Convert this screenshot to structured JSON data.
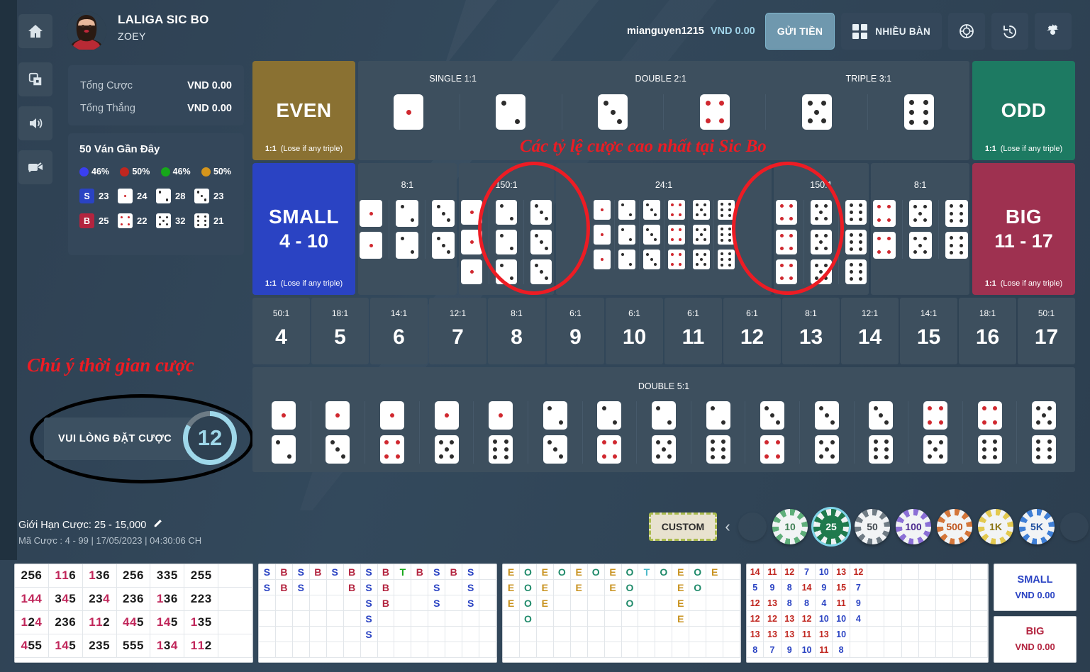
{
  "header": {
    "home_icon": "home-icon",
    "table_title": "LALIGA SIC BO",
    "dealer_name": "ZOEY",
    "username": "mianguyen1215",
    "balance": "VND 0.00",
    "deposit_label": "GỬI TIỀN",
    "multi_table_label": "NHIỀU BÀN",
    "icons": [
      "grid-icon",
      "chip-icon",
      "history-icon",
      "gear-icon"
    ]
  },
  "sidebar": {
    "icons": [
      "swap-table-icon",
      "sound-icon",
      "video-icon"
    ],
    "stats": {
      "total_bet_label": "Tổng Cược",
      "total_bet_value": "VND 0.00",
      "total_win_label": "Tổng Thắng",
      "total_win_value": "VND 0.00"
    },
    "recent": {
      "title": "50 Ván Gần Đây",
      "percents": [
        {
          "color": "#3a3ff0",
          "value": "46%"
        },
        {
          "color": "#c0261f",
          "value": "50%"
        },
        {
          "color": "#17a81a",
          "value": "46%"
        },
        {
          "color": "#d4951c",
          "value": "50%"
        }
      ],
      "row1": [
        {
          "badge": "S",
          "badge_color": "#2a43c3",
          "count": "23"
        },
        {
          "face": 1,
          "count": "24"
        },
        {
          "face": 2,
          "count": "28"
        },
        {
          "face": 3,
          "count": "23"
        }
      ],
      "row2": [
        {
          "badge": "B",
          "badge_color": "#b3243f",
          "count": "25"
        },
        {
          "face": 4,
          "count": "22"
        },
        {
          "face": 5,
          "count": "32"
        },
        {
          "face": 6,
          "count": "21"
        }
      ]
    }
  },
  "annotations": {
    "top_note": "Các tỷ lệ cược cao nhất tại Sic Bo",
    "timer_note": "Chú ý thời gian cược"
  },
  "timer": {
    "message": "VUI LÒNG ĐẶT CƯỢC",
    "seconds": "12"
  },
  "board": {
    "even": {
      "title": "EVEN",
      "odds": "1:1",
      "note": "(Lose if any triple)"
    },
    "odd": {
      "title": "ODD",
      "odds": "1:1",
      "note": "(Lose if any triple)"
    },
    "small": {
      "title": "SMALL",
      "range": "4 - 10",
      "odds": "1:1",
      "note": "(Lose if any triple)"
    },
    "big": {
      "title": "BIG",
      "range": "11 - 17",
      "odds": "1:1",
      "note": "(Lose if any triple)"
    },
    "single_row": {
      "labels": [
        {
          "text": "SINGLE 1:1",
          "pos": 15.5
        },
        {
          "text": "DOUBLE 2:1",
          "pos": 49.5
        },
        {
          "text": "TRIPLE 3:1",
          "pos": 83.5
        }
      ],
      "faces": [
        1,
        2,
        3,
        4,
        5,
        6
      ]
    },
    "combos": [
      {
        "odds": "8:1",
        "type": "pair",
        "groups": [
          [
            1,
            1
          ],
          [
            2,
            2
          ],
          [
            3,
            3
          ]
        ]
      },
      {
        "odds": "150:1",
        "type": "triple",
        "groups": [
          [
            1,
            1,
            1
          ],
          [
            2,
            2,
            2
          ],
          [
            3,
            3,
            3
          ]
        ],
        "circled": true
      },
      {
        "odds": "24:1",
        "type": "anytriple",
        "groups": [
          [
            1,
            1,
            1
          ],
          [
            2,
            2,
            2
          ],
          [
            3,
            3,
            3
          ],
          [
            4,
            4,
            4
          ],
          [
            5,
            5,
            5
          ],
          [
            6,
            6,
            6
          ]
        ]
      },
      {
        "odds": "150:1",
        "type": "triple",
        "groups": [
          [
            4,
            4,
            4
          ],
          [
            5,
            5,
            5
          ],
          [
            6,
            6,
            6
          ]
        ],
        "circled": true
      },
      {
        "odds": "8:1",
        "type": "pair",
        "groups": [
          [
            4,
            4
          ],
          [
            5,
            5
          ],
          [
            6,
            6
          ]
        ]
      }
    ],
    "numbers": [
      {
        "odds": "50:1",
        "value": "4"
      },
      {
        "odds": "18:1",
        "value": "5"
      },
      {
        "odds": "14:1",
        "value": "6"
      },
      {
        "odds": "12:1",
        "value": "7"
      },
      {
        "odds": "8:1",
        "value": "8"
      },
      {
        "odds": "6:1",
        "value": "9"
      },
      {
        "odds": "6:1",
        "value": "10"
      },
      {
        "odds": "6:1",
        "value": "11"
      },
      {
        "odds": "6:1",
        "value": "12"
      },
      {
        "odds": "8:1",
        "value": "13"
      },
      {
        "odds": "12:1",
        "value": "14"
      },
      {
        "odds": "14:1",
        "value": "15"
      },
      {
        "odds": "18:1",
        "value": "16"
      },
      {
        "odds": "50:1",
        "value": "17"
      }
    ],
    "double_row": {
      "label": "DOUBLE 5:1",
      "pairs": [
        [
          1,
          2
        ],
        [
          1,
          3
        ],
        [
          1,
          4
        ],
        [
          1,
          5
        ],
        [
          1,
          6
        ],
        [
          2,
          3
        ],
        [
          2,
          4
        ],
        [
          2,
          5
        ],
        [
          2,
          6
        ],
        [
          3,
          4
        ],
        [
          3,
          5
        ],
        [
          3,
          6
        ],
        [
          4,
          5
        ],
        [
          4,
          6
        ],
        [
          5,
          6
        ]
      ]
    }
  },
  "footer": {
    "limit_label": "Giới Hạn Cược:",
    "limit_value": "25 - 15,000",
    "edit_icon": "pencil-icon",
    "code_text": "Mã Cược : 4 - 99 | 17/05/2023 | 04:30:06 CH"
  },
  "chips": {
    "custom_label": "CUSTOM",
    "prev_icon": "chevron-left-icon",
    "next_icon": "chevron-right-icon",
    "items": [
      {
        "label": "10",
        "ring": "#5fae7a",
        "text": "#3f7f55",
        "selected": false
      },
      {
        "label": "25",
        "ring": "#1f7a4d",
        "text": "#1f7a4d",
        "selected": true
      },
      {
        "label": "50",
        "ring": "#6f7b84",
        "text": "#424a50",
        "selected": false
      },
      {
        "label": "100",
        "ring": "#8b6fd6",
        "text": "#4b2a8f",
        "selected": false
      },
      {
        "label": "500",
        "ring": "#d4763a",
        "text": "#c0561f",
        "selected": false
      },
      {
        "label": "1K",
        "ring": "#e3c94f",
        "text": "#8a7312",
        "selected": false
      },
      {
        "label": "5K",
        "ring": "#3f7fd6",
        "text": "#1f4f9f",
        "selected": false
      }
    ]
  },
  "roadmaps": {
    "bead_results": {
      "cols": 7,
      "rows": 4,
      "values": [
        [
          "256",
          "116",
          "136",
          "256",
          "335",
          "255",
          ""
        ],
        [
          "144",
          "345",
          "234",
          "236",
          "136",
          "223",
          ""
        ],
        [
          "124",
          "236",
          "112",
          "445",
          "145",
          "135",
          ""
        ],
        [
          "455",
          "145",
          "235",
          "555",
          "134",
          "112",
          ""
        ]
      ],
      "red_digits": [
        "1",
        "4"
      ],
      "red_color": "#c0265a",
      "black_color": "#1a1a1a"
    },
    "bigsmall_road": {
      "cols": 14,
      "rows": 6,
      "colors": {
        "S": "#2a43c3",
        "B": "#b3243f",
        "T": "#17a81a"
      },
      "columns": [
        [
          "S",
          "S"
        ],
        [
          "B",
          "B"
        ],
        [
          "S",
          "S"
        ],
        [
          "B"
        ],
        [
          "S"
        ],
        [
          "B",
          "B"
        ],
        [
          "S",
          "S",
          "S",
          "S",
          "S"
        ],
        [
          "B",
          "B",
          "B"
        ],
        [
          "T"
        ],
        [
          "B"
        ],
        [
          "S",
          "S",
          "S"
        ],
        [
          "B"
        ],
        [
          "S",
          "S",
          "S"
        ],
        []
      ]
    },
    "evenodd_road": {
      "cols": 14,
      "rows": 6,
      "colors": {
        "E": "#c8921f",
        "O": "#1f8a6a",
        "T": "#4ab8c8"
      },
      "columns": [
        [
          "E",
          "E",
          "E"
        ],
        [
          "O",
          "O",
          "O",
          "O"
        ],
        [
          "E",
          "E",
          "E"
        ],
        [
          "O"
        ],
        [
          "E",
          "E"
        ],
        [
          "O"
        ],
        [
          "E",
          "E"
        ],
        [
          "O",
          "O",
          "O"
        ],
        [
          "T"
        ],
        [
          "O"
        ],
        [
          "E",
          "E",
          "E",
          "E"
        ],
        [
          "O",
          "O"
        ],
        [
          "E"
        ],
        []
      ]
    },
    "totals_road": {
      "cols": 14,
      "rows": 6,
      "big_color": "#c0261f",
      "small_color": "#2a43c3",
      "rows_values": [
        [
          "14",
          "11",
          "12",
          "7",
          "10",
          "13",
          "12"
        ],
        [
          "5",
          "9",
          "8",
          "14",
          "9",
          "15",
          "7"
        ],
        [
          "12",
          "13",
          "8",
          "8",
          "4",
          "11",
          "9"
        ],
        [
          "12",
          "12",
          "13",
          "12",
          "10",
          "10",
          "4"
        ],
        [
          "13",
          "13",
          "13",
          "11",
          "13",
          "10",
          ""
        ],
        [
          "8",
          "7",
          "9",
          "10",
          "11",
          "8",
          ""
        ]
      ]
    },
    "side_bets": [
      {
        "name": "SMALL",
        "value": "VND 0.00",
        "style": "small"
      },
      {
        "name": "BIG",
        "value": "VND 0.00",
        "style": "big"
      }
    ]
  }
}
